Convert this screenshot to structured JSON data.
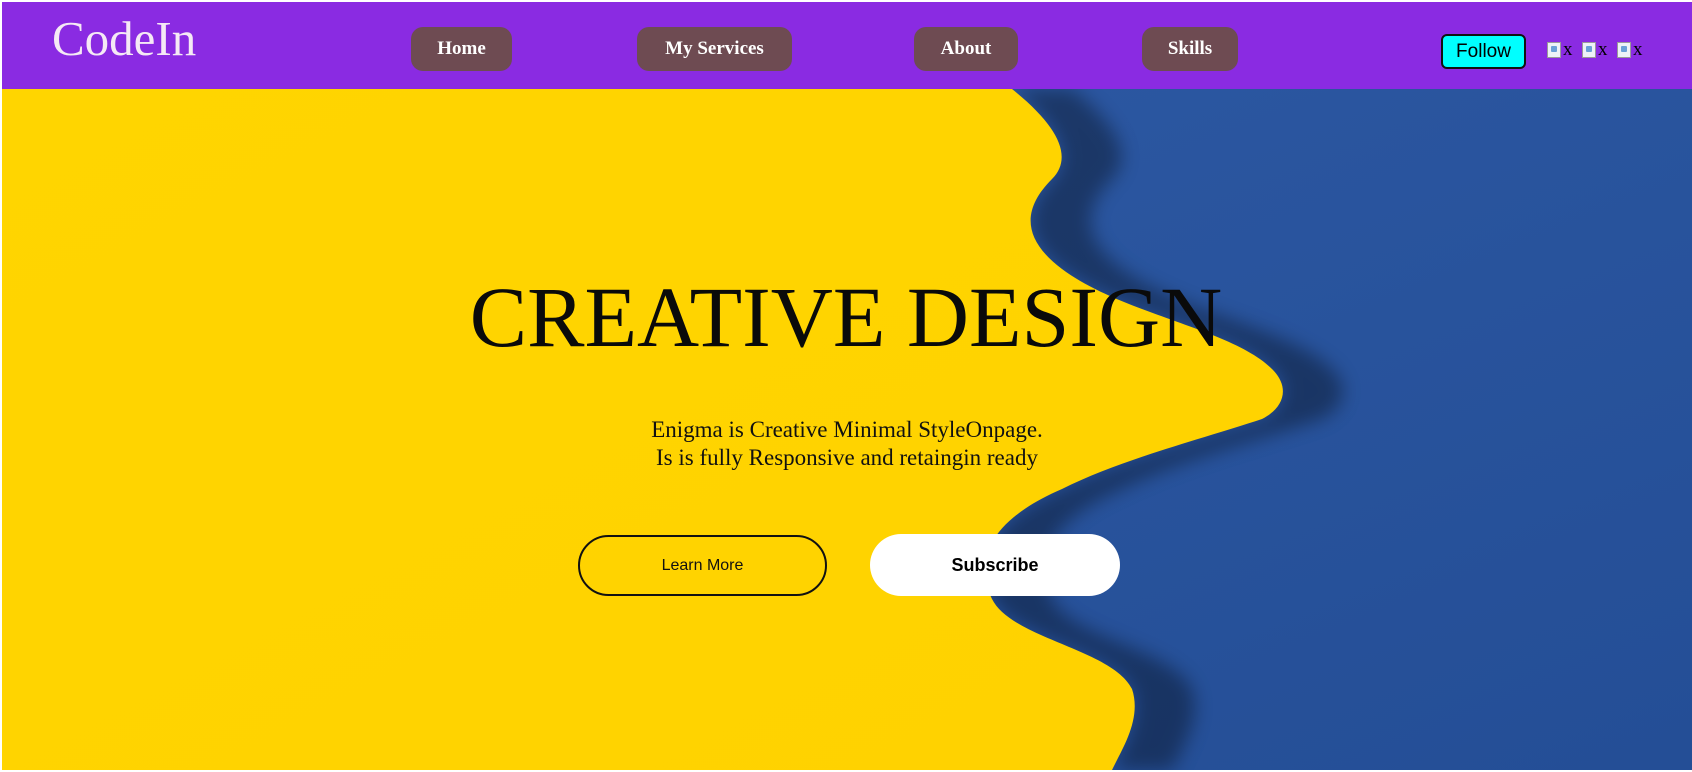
{
  "header": {
    "logo": "CodeIn",
    "nav": {
      "home": "Home",
      "services": "My Services",
      "about": "About",
      "skills": "Skills"
    },
    "follow_label": "Follow",
    "social": [
      {
        "icon": "broken-image-icon",
        "alt": "x"
      },
      {
        "icon": "broken-image-icon",
        "alt": "x"
      },
      {
        "icon": "broken-image-icon",
        "alt": "x"
      }
    ]
  },
  "hero": {
    "title": "CREATIVE DESIGN",
    "subtitle_line1": "Enigma is Creative Minimal StyleOnpage.",
    "subtitle_line2": "Is is fully Responsive and retaingin ready",
    "learn_more_label": "Learn More",
    "subscribe_label": "Subscribe"
  },
  "colors": {
    "navbar": "#8a2be2",
    "nav_button": "#6e4b52",
    "follow_button": "#00ffff",
    "hero_yellow": "#ffd600",
    "hero_blue": "#2a55a0"
  }
}
